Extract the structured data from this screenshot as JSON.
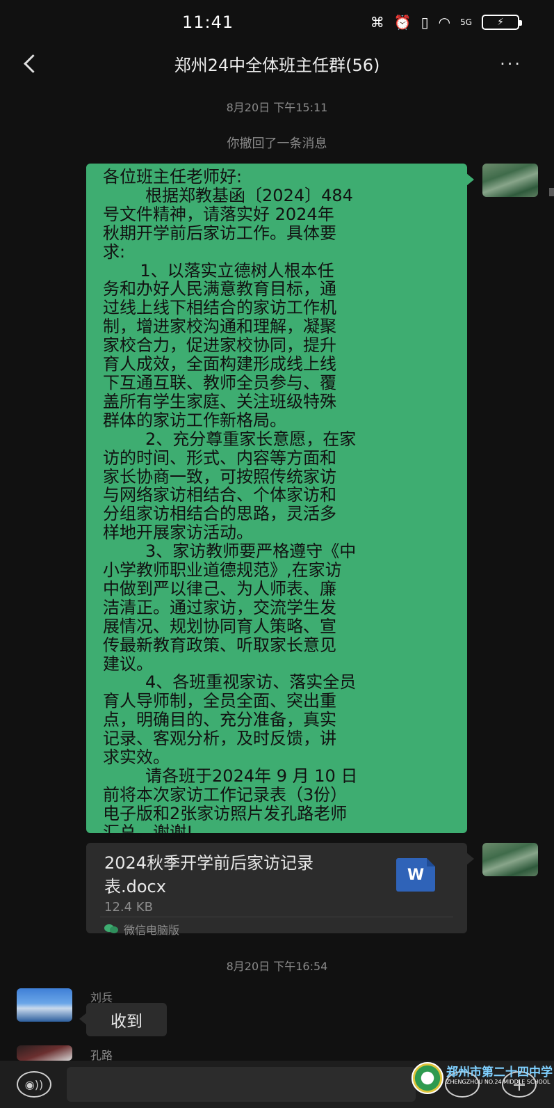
{
  "status_bar": {
    "time": "11:41",
    "icons": [
      "nfc-icon",
      "alarm-icon",
      "vibrate-icon",
      "wifi-icon",
      "signal-5g-icon",
      "battery-charging-icon"
    ],
    "network_label": "5G"
  },
  "nav": {
    "title": "郑州24中全体班主任群(56)",
    "more": "···"
  },
  "chat": {
    "timestamp_1": "8月20日 下午15:11",
    "recall_note": "你撤回了一条消息",
    "message_lines": [
      "各位班主任老师好:",
      "        根据郑教基函〔2024〕484",
      "号文件精神，请落实好 2024年",
      "秋期开学前后家访工作。具体要",
      "求:",
      "       1、以落实立德树人根本任",
      "务和办好人民满意教育目标，通",
      "过线上线下相结合的家访工作机",
      "制，增进家校沟通和理解，凝聚",
      "家校合力，促进家校协同，提升",
      "育人成效，全面构建形成线上线",
      "下互通互联、教师全员参与、覆",
      "盖所有学生家庭、关注班级特殊",
      "群体的家访工作新格局。",
      "        2、充分尊重家长意愿，在家",
      "访的时间、形式、内容等方面和",
      "家长协商一致，可按照传统家访",
      "与网络家访相结合、个体家访和",
      "分组家访相结合的思路，灵活多",
      "样地开展家访活动。",
      "        3、家访教师要严格遵守《中",
      "小学教师职业道德规范》,在家访",
      "中做到严以律己、为人师表、廉",
      "洁清正。通过家访，交流学生发",
      "展情况、规划协同育人策略、宣",
      "传最新教育政策、听取家长意见",
      "建议。",
      "        4、各班重视家访、落实全员",
      "育人导师制，全员全面、突出重",
      "点，明确目的、充分准备，真实",
      "记录、客观分析，及时反馈，讲",
      "求实效。",
      "        请各班于2024年 9 月 10 日",
      "前将本次家访工作记录表（3份）",
      "电子版和2张家访照片发孔路老师",
      "汇总。谢谢!"
    ],
    "file": {
      "name": "2024秋季开学前后家访记录表.docx",
      "size": "12.4 KB",
      "type_icon": "word-doc-icon",
      "type_letter": "W",
      "source": "微信电脑版"
    },
    "timestamp_2": "8月20日 下午16:54",
    "reply_sender": "刘兵",
    "reply_text": "收到",
    "next_sender": "孔路"
  },
  "watermark": {
    "title": "郑州市第二十四中学",
    "subtitle": "ZHENGZHOU NO.24 MIDDLE SCHOOL"
  },
  "colors": {
    "background": "#111111",
    "own_bubble": "#3ead71",
    "other_bubble": "#2c2c2c",
    "muted_text": "#8a8a8a"
  }
}
